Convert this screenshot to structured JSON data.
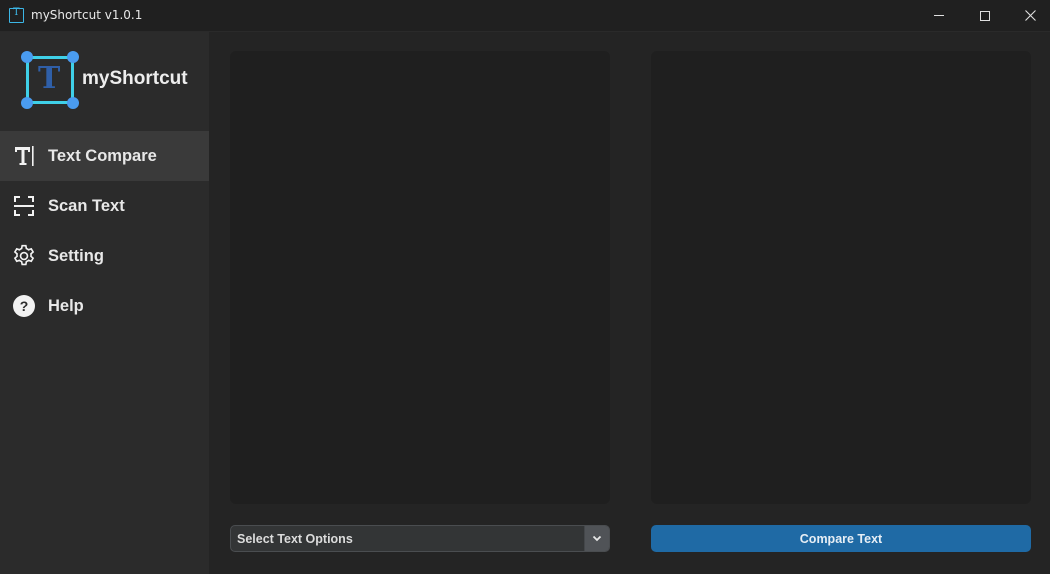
{
  "window": {
    "title": "myShortcut v1.0.1",
    "icon": "app-text-icon"
  },
  "sidebar": {
    "logo_text": "myShortcut",
    "logo_icon": "logo-T-icon",
    "items": [
      {
        "label": "Text Compare",
        "icon": "text-icon",
        "active": true
      },
      {
        "label": "Scan Text",
        "icon": "scan-icon",
        "active": false
      },
      {
        "label": "Setting",
        "icon": "gear-icon",
        "active": false
      },
      {
        "label": "Help",
        "icon": "help-icon",
        "active": false
      }
    ]
  },
  "main": {
    "left_text": "",
    "right_text": "",
    "select": {
      "value": "Select Text Options"
    },
    "compare_button": "Compare Text"
  },
  "colors": {
    "accent": "#1f6aa5",
    "logo_frame": "#3fd0e8",
    "logo_corners": "#4a9cf0",
    "sidebar_bg": "#2b2b2b",
    "main_bg": "#242424",
    "panel_bg": "#1f1f1f"
  }
}
